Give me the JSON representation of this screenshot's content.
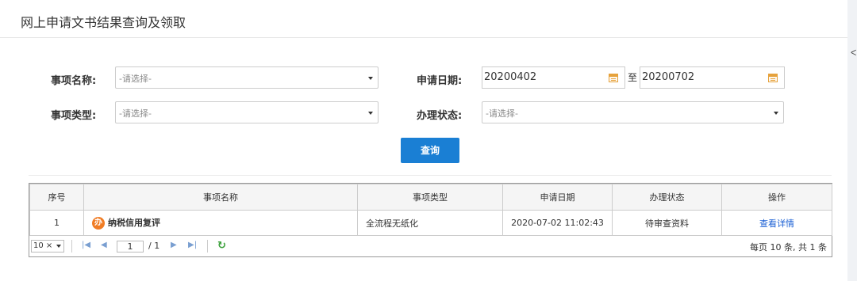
{
  "panel": {
    "title": "网上申请文书结果查询及领取",
    "edge_char": "ᐸ"
  },
  "form": {
    "item_name_label": "事项名称:",
    "item_name_placeholder": "-请选择-",
    "apply_date_label": "申请日期:",
    "date_from": "20200402",
    "to_label": "至",
    "date_to": "20200702",
    "item_type_label": "事项类型:",
    "item_type_placeholder": "-请选择-",
    "status_label": "办理状态:",
    "status_placeholder": "-请选择-",
    "query_button": "查询"
  },
  "table": {
    "columns": [
      "序号",
      "事项名称",
      "事项类型",
      "申请日期",
      "办理状态",
      "操作"
    ],
    "rows": [
      {
        "index": "1",
        "icon_text": "办",
        "name": "纳税信用复评",
        "type": "全流程无纸化",
        "date": "2020-07-02 11:02:43",
        "status": "待审查资料",
        "action": "查看详情"
      }
    ]
  },
  "pager": {
    "page_size": "10 ×",
    "first": "|◀",
    "prev": "◀",
    "current_page": "1",
    "total_pages": "/ 1",
    "next": "▶",
    "last": "▶|",
    "refresh": "↻",
    "info": "每页 10 条, 共 1 条"
  }
}
